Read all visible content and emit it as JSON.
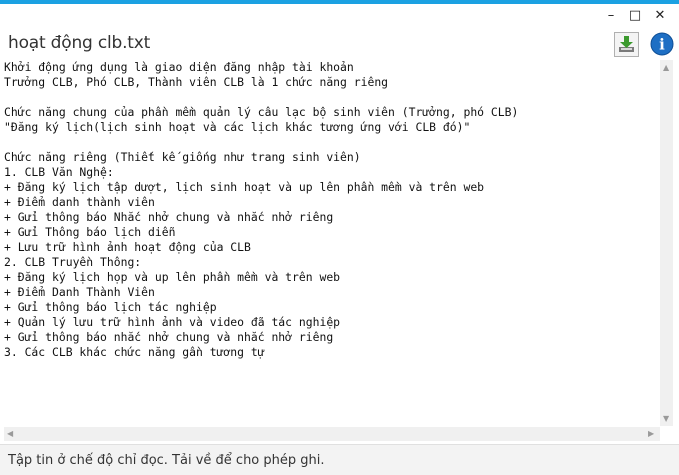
{
  "window": {
    "title": "hoạt động clb.txt",
    "controls": {
      "minimize": "–",
      "maximize": "□",
      "close": "✕"
    }
  },
  "toolbar": {
    "download_icon": "download-icon",
    "info_icon": "info-icon",
    "info_glyph": "i"
  },
  "document": {
    "lines": [
      "Khởi động ứng dụng là giao diện đăng nhập tài khoản",
      "Trưởng CLB, Phó CLB, Thành viên CLB là 1 chức năng riêng",
      "",
      "Chức năng chung của phần mềm quản lý câu lạc bộ sinh viên (Trưởng, phó CLB)",
      "\"Đăng ký lịch(lịch sinh hoạt và các lịch khác tương ứng với CLB đó)\"",
      "",
      "Chức năng riêng (Thiết kế giống như trang sinh viên)",
      "1. CLB Văn Nghệ:",
      "+ Đăng ký lịch tập dượt, lịch sinh hoạt và up lên phần mềm và trên web",
      "+ Điểm danh thành viên",
      "+ Gửi thông báo Nhắc nhở chung và nhắc nhở riêng",
      "+ Gửi Thông báo lịch diễn",
      "+ Lưu trữ hình ảnh hoạt động của CLB",
      "2. CLB Truyền Thông:",
      "+ Đăng ký lịch họp và up lên phần mềm và trên web",
      "+ Điểm Danh Thành Viên",
      "+ Gửi thông báo lịch tác nghiệp",
      "+ Quản lý lưu trữ hình ảnh và video đã tác nghiệp",
      "+ Gửi thông báo nhắc nhở chung và nhắc nhở riêng",
      "3. Các CLB khác chức năng gần tương tự"
    ]
  },
  "scrollbars": {
    "up": "▲",
    "down": "▼",
    "left": "◀",
    "right": "▶"
  },
  "status": {
    "text": "Tập tin ở chế độ chỉ đọc. Tải về để cho phép ghi."
  },
  "colors": {
    "accent": "#1ba1e2",
    "download_green": "#3c9a2e",
    "info_blue": "#1e6fc4"
  }
}
